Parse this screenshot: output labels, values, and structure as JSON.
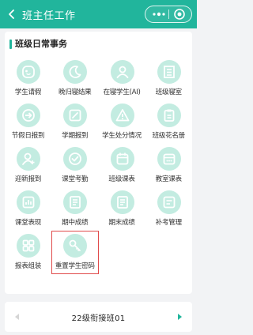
{
  "header": {
    "title": "班主任工作",
    "back_icon": "chevron-left-icon",
    "more_icon": "more-dots-icon",
    "close_icon": "target-circle-icon"
  },
  "colors": {
    "accent": "#21b59c",
    "icon_bg": "#c3ece1",
    "highlight": "#e04a4a"
  },
  "section": {
    "title": "班级日常事务"
  },
  "tiles": [
    {
      "label": "学生请假",
      "icon": "smile-face-icon"
    },
    {
      "label": "晚归寝结果",
      "icon": "moon-icon"
    },
    {
      "label": "在寝学生(AI)",
      "icon": "person-check-icon"
    },
    {
      "label": "班级寝室",
      "icon": "building-icon"
    },
    {
      "label": "节假日报到",
      "icon": "arrow-circle-icon"
    },
    {
      "label": "学期报到",
      "icon": "edit-doc-icon"
    },
    {
      "label": "学生处分情况",
      "icon": "warning-triangle-icon"
    },
    {
      "label": "班级花名册",
      "icon": "clipboard-icon"
    },
    {
      "label": "迎新报到",
      "icon": "user-add-icon"
    },
    {
      "label": "课堂考勤",
      "icon": "check-circle-icon"
    },
    {
      "label": "班级课表",
      "icon": "calendar-icon"
    },
    {
      "label": "教室课表",
      "icon": "calendar-grid-icon"
    },
    {
      "label": "课堂表现",
      "icon": "chart-doc-icon"
    },
    {
      "label": "期中成绩",
      "icon": "list-doc-icon"
    },
    {
      "label": "期末成绩",
      "icon": "list-doc-icon"
    },
    {
      "label": "补考管理",
      "icon": "exam-icon"
    },
    {
      "label": "报表组装",
      "icon": "grid-blocks-icon"
    },
    {
      "label": "重置学生密码",
      "icon": "key-icon"
    }
  ],
  "class_selector": {
    "current": "22级衔接班01"
  }
}
